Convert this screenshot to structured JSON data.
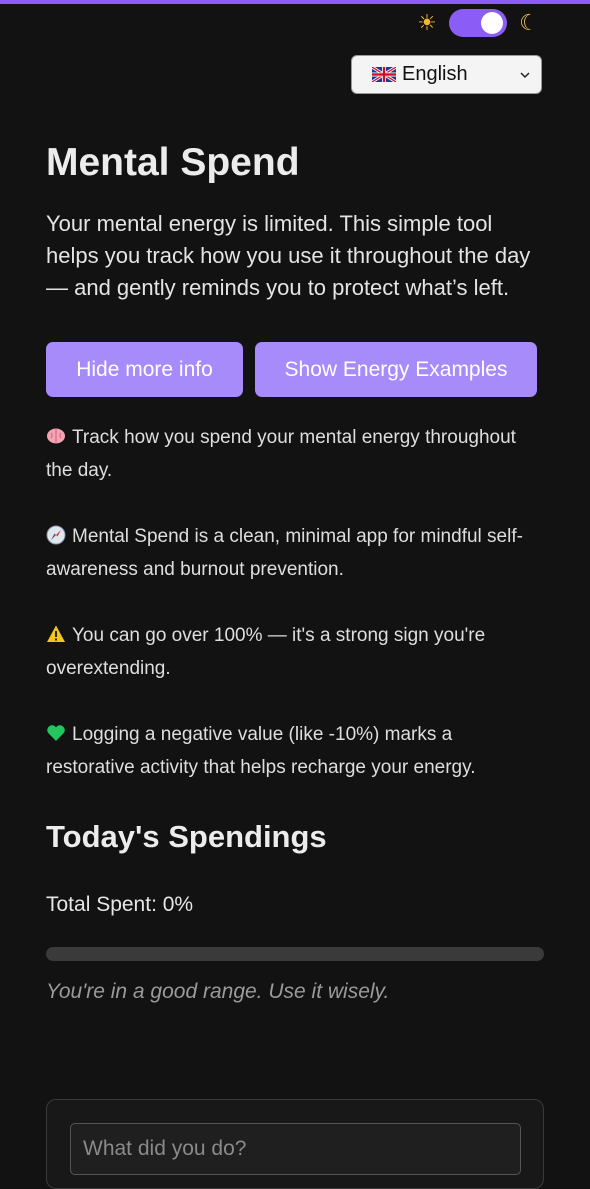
{
  "theme": {
    "sun_icon": "sun-icon",
    "moon_icon": "moon-icon",
    "dark_mode": true,
    "accent_color": "#8b5cf6"
  },
  "language": {
    "flag": "uk-flag-icon",
    "selected": "English"
  },
  "header": {
    "title": "Mental Spend",
    "intro": "Your mental energy is limited. This simple tool helps you track how you use it throughout the day — and gently reminds you to protect what’s left."
  },
  "buttons": {
    "hide_info": "Hide more info",
    "show_examples": "Show Energy Examples",
    "color": "#a78bfa"
  },
  "info": [
    {
      "icon": "brain-icon",
      "text": "Track how you spend your mental energy throughout the day."
    },
    {
      "icon": "compass-icon",
      "text": "Mental Spend is a clean, minimal app for mindful self-awareness and burnout prevention."
    },
    {
      "icon": "warning-icon",
      "text": "You can go over 100% — it's a strong sign you're overextending."
    },
    {
      "icon": "green-heart-icon",
      "text": "Logging a negative value (like -10%) marks a restorative activity that helps recharge your energy."
    }
  ],
  "spendings": {
    "title": "Today's Spendings",
    "total_label": "Total Spent: 0%",
    "total_percent": 0,
    "status": "You're in a good range. Use it wisely."
  },
  "form": {
    "activity_placeholder": "What did you do?"
  }
}
